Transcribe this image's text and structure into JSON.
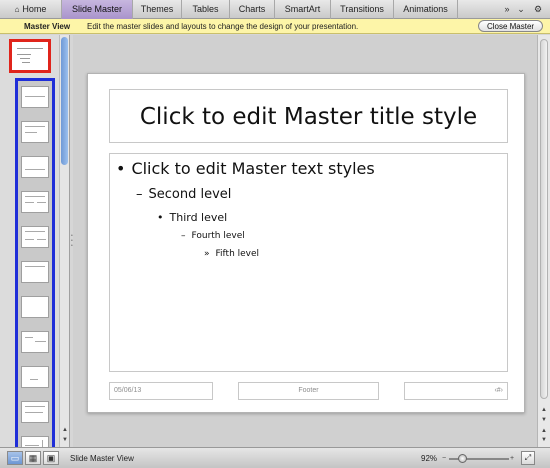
{
  "ribbon": {
    "tabs": [
      {
        "label": "Home",
        "icon": "home-icon"
      },
      {
        "label": "Slide Master"
      },
      {
        "label": "Themes"
      },
      {
        "label": "Tables"
      },
      {
        "label": "Charts"
      },
      {
        "label": "SmartArt"
      },
      {
        "label": "Transitions"
      },
      {
        "label": "Animations"
      }
    ],
    "active_tab": "Slide Master",
    "overflow_glyph": "»",
    "collapse_glyph": "⌄",
    "gear_glyph": "⚙",
    "active_color": "#b09bd1"
  },
  "master_bar": {
    "label": "Master View",
    "description": "Edit the master slides and layouts to change the design of your presentation.",
    "close_button": "Close Master",
    "background": "#fdf5a8"
  },
  "thumbnails": {
    "master_highlight_color": "#e0241b",
    "layouts_highlight_color": "#1f2ed8",
    "layout_count": 11
  },
  "slide": {
    "title": "Click to edit Master title style",
    "levels": [
      {
        "bullet": "•",
        "text": "Click to edit Master text styles"
      },
      {
        "bullet": "–",
        "text": "Second level"
      },
      {
        "bullet": "•",
        "text": "Third level"
      },
      {
        "bullet": "–",
        "text": "Fourth level"
      },
      {
        "bullet": "»",
        "text": "Fifth level"
      }
    ],
    "footer_date": "05/06/13",
    "footer_text": "Footer",
    "footer_number": "‹#›"
  },
  "status": {
    "view_label": "Slide Master View",
    "zoom": "92%",
    "zoom_minus": "−",
    "zoom_plus": "+"
  }
}
